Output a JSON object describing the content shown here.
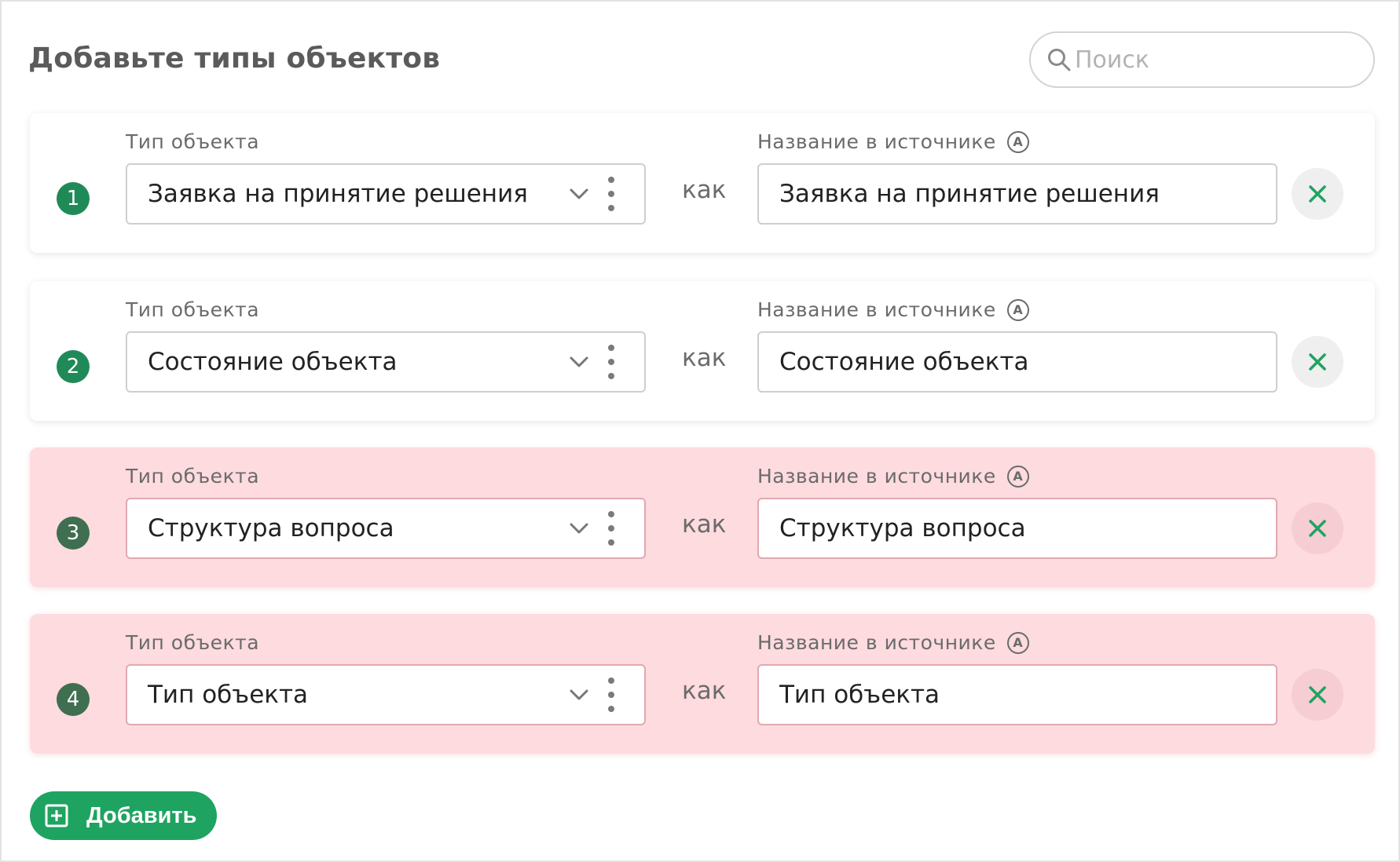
{
  "header": {
    "title": "Добавьте типы объектов",
    "search_placeholder": "Поиск"
  },
  "labels": {
    "type": "Тип объекта",
    "source_name": "Название в источнике",
    "auto_badge": "A",
    "as_word": "как"
  },
  "rows": [
    {
      "number": "1",
      "type": "Заявка на принятие решения",
      "source_name": "Заявка на принятие решения",
      "status": "ok"
    },
    {
      "number": "2",
      "type": "Состояние объекта",
      "source_name": "Состояние объекта",
      "status": "ok"
    },
    {
      "number": "3",
      "type": "Структура вопроса",
      "source_name": "Структура вопроса",
      "status": "error"
    },
    {
      "number": "4",
      "type": "Тип объекта",
      "source_name": "Тип объекта",
      "status": "error"
    }
  ],
  "footer": {
    "add_label": "Добавить"
  },
  "colors": {
    "accent": "#1fa361",
    "error_background": "#fddbdf",
    "remove_x": "#1fa361"
  },
  "icons": {
    "search": "search-icon",
    "chevron": "chevron-down-icon",
    "menu": "kebab-menu-icon",
    "auto": "auto-a-icon",
    "remove": "close-icon",
    "add": "plus-square-icon"
  }
}
